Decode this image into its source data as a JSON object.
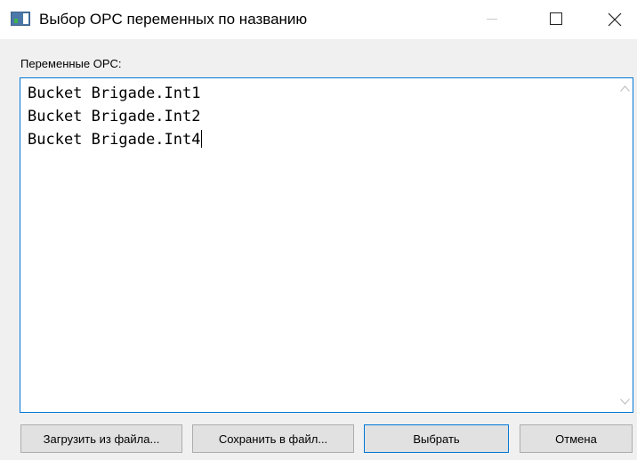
{
  "window": {
    "title": "Выбор OPC переменных по названию",
    "icon": "app-window-icon",
    "controls": {
      "minimize_icon": "minimize-icon",
      "maximize_icon": "maximize-icon",
      "close_icon": "close-icon"
    }
  },
  "form": {
    "label": "Переменные OPC:",
    "lines": [
      "Bucket Brigade.Int1",
      "Bucket Brigade.Int2",
      "Bucket Brigade.Int4"
    ]
  },
  "buttons": {
    "load": "Загрузить из файла...",
    "save": "Сохранить в файл...",
    "select": "Выбрать",
    "cancel": "Отмена"
  },
  "colors": {
    "focus_accent": "#0078d7",
    "window_background": "#f0f0f0",
    "button_background": "#e1e1e1"
  }
}
